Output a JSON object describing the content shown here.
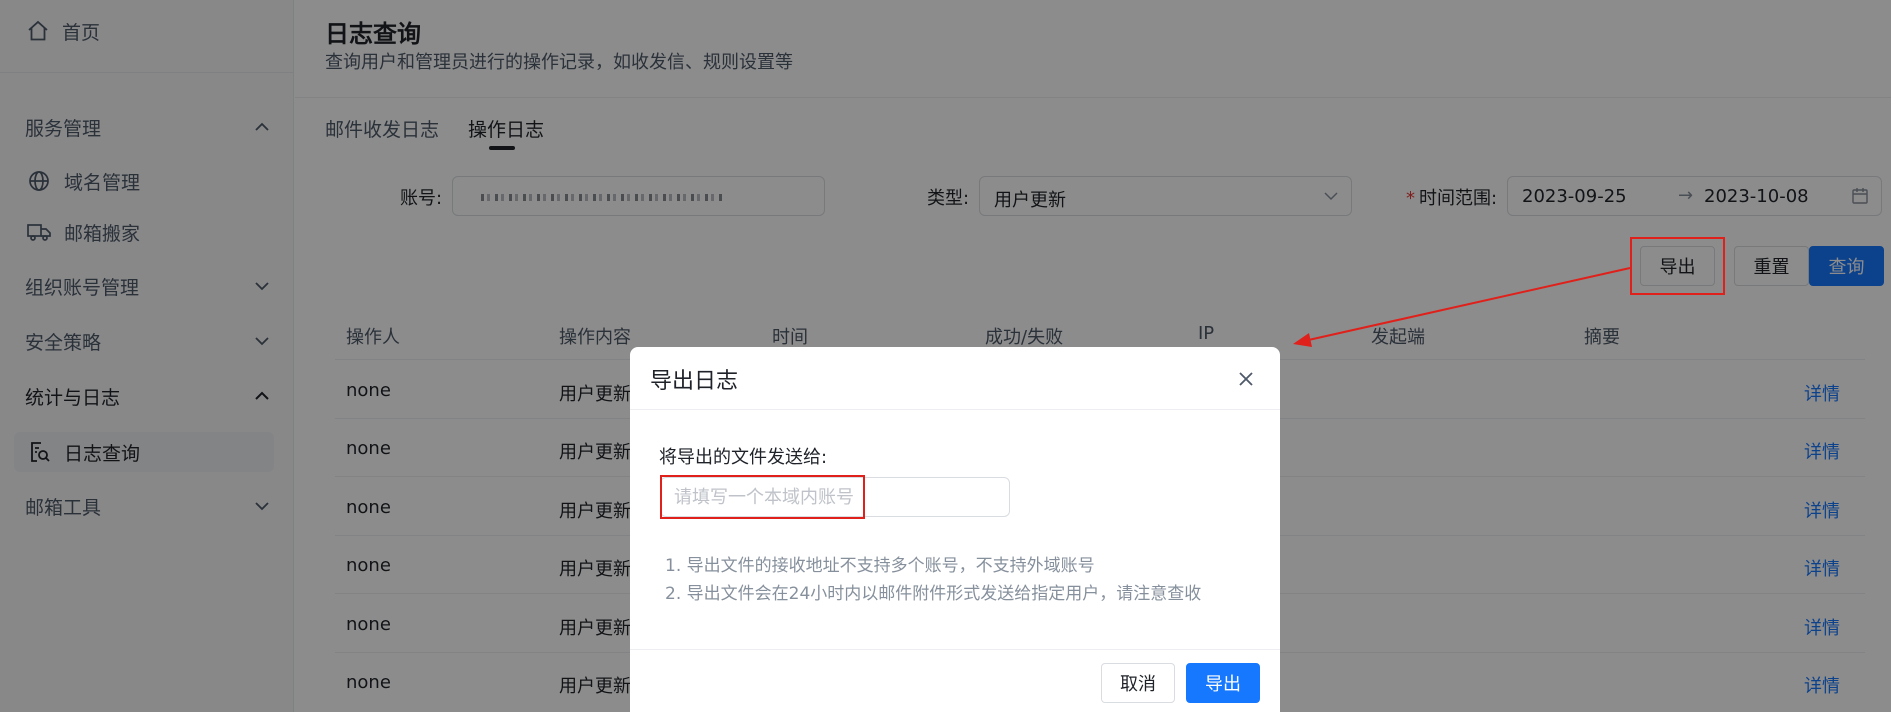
{
  "sidebar": {
    "home": "首页",
    "groups": {
      "service": "服务管理",
      "domain": "域名管理",
      "migrate": "邮箱搬家",
      "org": "组织账号管理",
      "security": "安全策略",
      "stats": "统计与日志",
      "log_query": "日志查询",
      "tools": "邮箱工具"
    }
  },
  "header": {
    "title": "日志查询",
    "subtitle": "查询用户和管理员进行的操作记录，如收发信、规则设置等"
  },
  "tabs": [
    "邮件收发日志",
    "操作日志"
  ],
  "filters": {
    "account_label": "账号:",
    "type_label": "类型:",
    "type_value": "用户更新",
    "time_label": "时间范围:",
    "date_from": "2023-09-25",
    "date_arrow": "→",
    "date_to": "2023-10-08"
  },
  "actions": {
    "export": "导出",
    "reset": "重置",
    "query": "查询"
  },
  "table": {
    "columns": [
      "操作人",
      "操作内容",
      "时间",
      "成功/失败",
      "IP",
      "发起端",
      "摘要"
    ],
    "rows": [
      {
        "operator": "none",
        "content": "用户更新",
        "link": "详情"
      },
      {
        "operator": "none",
        "content": "用户更新",
        "link": "详情"
      },
      {
        "operator": "none",
        "content": "用户更新",
        "link": "详情"
      },
      {
        "operator": "none",
        "content": "用户更新",
        "link": "详情"
      },
      {
        "operator": "none",
        "content": "用户更新",
        "link": "详情"
      },
      {
        "operator": "none",
        "content": "用户更新",
        "link": "详情"
      }
    ]
  },
  "modal": {
    "title": "导出日志",
    "field_label": "将导出的文件发送给:",
    "placeholder": "请填写一个本域内账号",
    "notes": [
      "1. 导出文件的接收地址不支持多个账号，不支持外域账号",
      "2. 导出文件会在24小时内以邮件附件形式发送给指定用户，请注意查收"
    ],
    "cancel": "取消",
    "confirm": "导出"
  },
  "colors": {
    "primary": "#1677ff",
    "annotation": "#e0201a"
  }
}
